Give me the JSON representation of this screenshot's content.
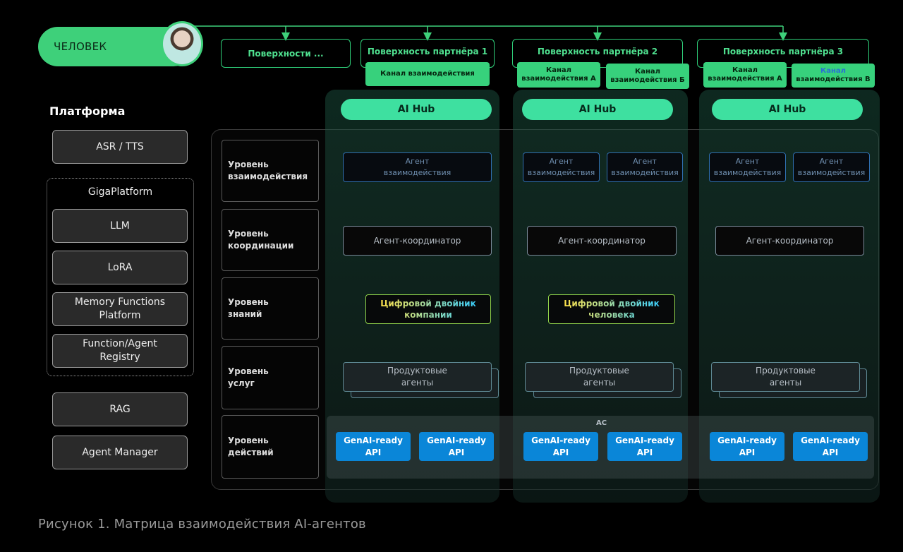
{
  "human": {
    "label": "ЧЕЛОВЕК"
  },
  "surfaces": [
    {
      "label": "Поверхности ...",
      "channels": []
    },
    {
      "label": "Поверхность партнёра 1",
      "channels": [
        {
          "text": "Канал взаимодействия",
          "highlight": null
        }
      ]
    },
    {
      "label": "Поверхность партнёра 2",
      "channels": [
        {
          "text": "Канал\nвзаимодействия А",
          "highlight": null
        },
        {
          "text": "Канал\nвзаимодействия Б",
          "highlight": null
        }
      ]
    },
    {
      "label": "Поверхность партнёра 3",
      "channels": [
        {
          "text": "Канал\nвзаимодействия А",
          "highlight": null
        },
        {
          "text": "взаимодействия В",
          "highlight": "Канал"
        }
      ]
    }
  ],
  "platform": {
    "title": "Платформа",
    "asr": "ASR / TTS",
    "giga": {
      "title": "GigaPlatform",
      "items": [
        "LLM",
        "LoRA",
        "Memory Functions\nPlatform",
        "Function/Agent\nRegistry"
      ]
    },
    "rag": "RAG",
    "agent_manager": "Agent Manager"
  },
  "levels": [
    "Уровень\nвзаимодействия",
    "Уровень\nкоординации",
    "Уровень\nзнаний",
    "Уровень\nуслуг",
    "Уровень\nдействий"
  ],
  "columns": [
    {
      "hub": "AI Hub",
      "interaction_agents": [
        "Агент\nвзаимодействия"
      ],
      "coordinator": "Агент-координатор",
      "twin": "Цифровой двойник\nкомпании",
      "products": "Продуктовые\nагенты",
      "apis": [
        "GenAI-ready\nAPI",
        "GenAI-ready\nAPI"
      ]
    },
    {
      "hub": "AI Hub",
      "interaction_agents": [
        "Агент\nвзаимодействия",
        "Агент\nвзаимодействия"
      ],
      "coordinator": "Агент-координатор",
      "twin": "Цифровой двойник\nчеловека",
      "products": "Продуктовые\nагенты",
      "apis": [
        "GenAI-ready\nAPI",
        "GenAI-ready\nAPI"
      ]
    },
    {
      "hub": "AI Hub",
      "interaction_agents": [
        "Агент\nвзаимодействия",
        "Агент\nвзаимодействия"
      ],
      "coordinator": "Агент-координатор",
      "twin": null,
      "products": "Продуктовые\nагенты",
      "apis": [
        "GenAI-ready\nAPI",
        "GenAI-ready\nAPI"
      ]
    }
  ],
  "ac_label": "АС",
  "caption": "Рисунок 1. Матрица взаимодействия AI-агентов",
  "colors": {
    "green": "#3ed07a",
    "hub": "#3ee0a0",
    "api": "#0a86d8",
    "twin_border": "#8fd24a",
    "agent_border": "#2f6fb0"
  }
}
